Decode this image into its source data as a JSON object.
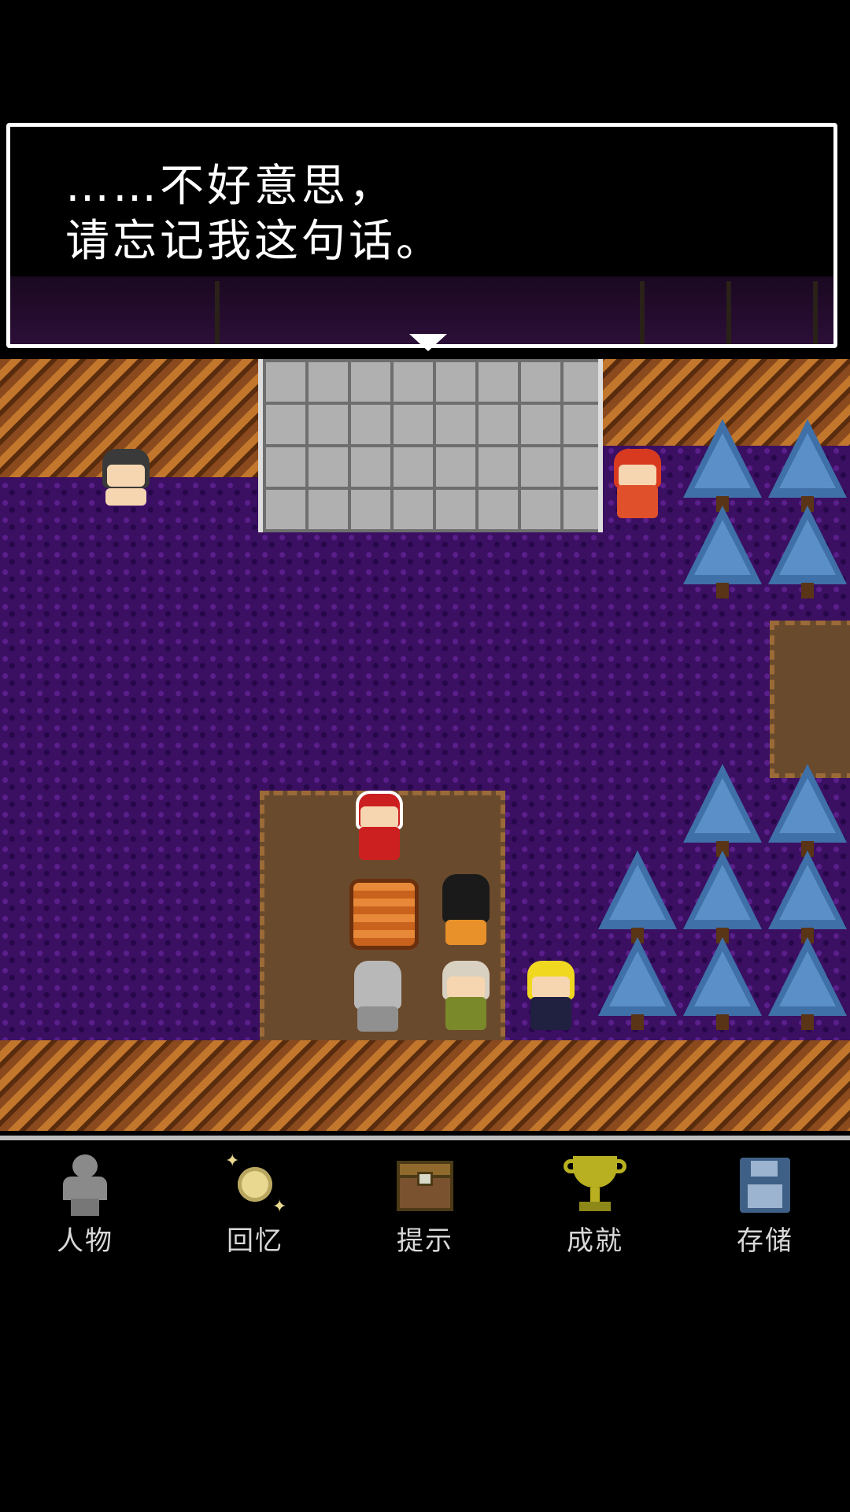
{
  "dialog": {
    "line1": "……不好意思，",
    "line2": "请忘记我这句话。"
  },
  "menu": {
    "items": [
      {
        "label": "人物",
        "icon": "person-icon"
      },
      {
        "label": "回忆",
        "icon": "memory-orb-icon"
      },
      {
        "label": "提示",
        "icon": "treasure-chest-icon"
      },
      {
        "label": "成就",
        "icon": "trophy-icon"
      },
      {
        "label": "存储",
        "icon": "floppy-disk-icon"
      }
    ]
  },
  "colors": {
    "background": "#000000",
    "ground": "#3b0f62",
    "tree": "#3f70a8",
    "menu_text": "#d8d8d8"
  }
}
